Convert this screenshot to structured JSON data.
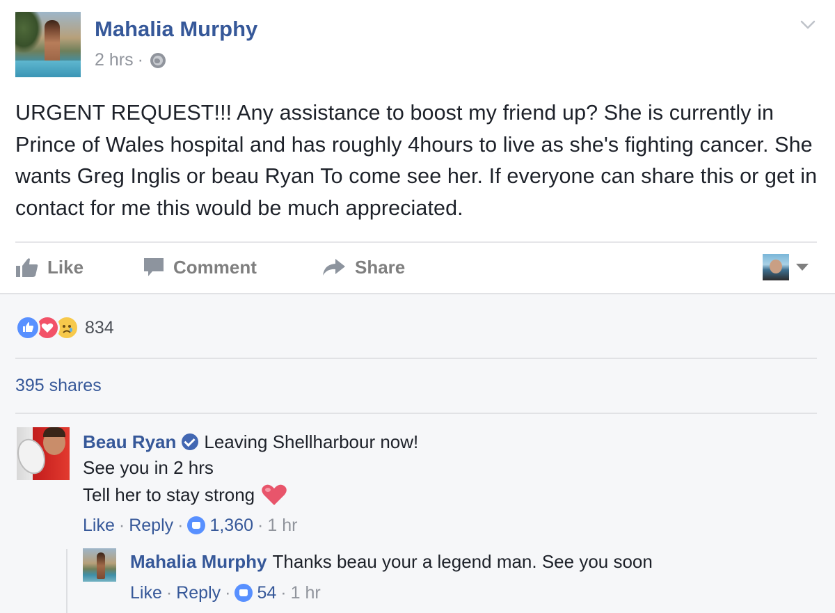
{
  "post": {
    "author": "Mahalia Murphy",
    "time": "2 hrs",
    "meta_sep": "·",
    "body": "URGENT REQUEST!!! Any assistance to boost my friend up? She is currently in Prince of Wales hospital and has roughly 4hours to live as she's fighting cancer. She wants Greg Inglis or beau Ryan To come see her. If everyone can share this or get in contact for me this would be much appreciated."
  },
  "actions": {
    "like": "Like",
    "comment": "Comment",
    "share": "Share"
  },
  "reactions": {
    "count": "834"
  },
  "shares": "395 shares",
  "comments": [
    {
      "author": "Beau Ryan",
      "lines": [
        "Leaving Shellharbour now!",
        "See you in 2 hrs",
        "Tell her to stay strong"
      ],
      "like_label": "Like",
      "reply_label": "Reply",
      "likes": "1,360",
      "time": "1 hr",
      "replies": [
        {
          "author": "Mahalia Murphy",
          "text": "Thanks beau your a legend man. See you soon",
          "like_label": "Like",
          "reply_label": "Reply",
          "likes": "54",
          "time": "1 hr"
        }
      ]
    }
  ],
  "colors": {
    "link": "#365899",
    "muted": "#90949c",
    "like_blue": "#5890ff",
    "love_red": "#f25268",
    "heart": "#e8556b"
  }
}
